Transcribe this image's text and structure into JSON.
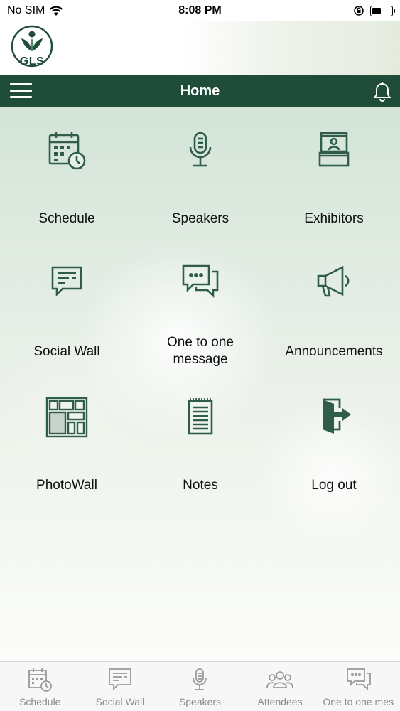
{
  "status": {
    "carrier": "No SIM",
    "time": "8:08 PM"
  },
  "brand": {
    "logo_text": "GLS"
  },
  "nav": {
    "title": "Home"
  },
  "menu": [
    {
      "label": "Schedule",
      "icon": "calendar-clock-icon"
    },
    {
      "label": "Speakers",
      "icon": "microphone-icon"
    },
    {
      "label": "Exhibitors",
      "icon": "exhibitor-booth-icon"
    },
    {
      "label": "Social Wall",
      "icon": "chat-bubble-icon"
    },
    {
      "label": "One to one message",
      "icon": "chat-bubbles-icon"
    },
    {
      "label": "Announcements",
      "icon": "megaphone-icon"
    },
    {
      "label": "PhotoWall",
      "icon": "photo-wall-icon"
    },
    {
      "label": "Notes",
      "icon": "notepad-icon"
    },
    {
      "label": "Log out",
      "icon": "logout-door-icon"
    }
  ],
  "tabs": [
    {
      "label": "Schedule",
      "icon": "calendar-clock-icon"
    },
    {
      "label": "Social Wall",
      "icon": "chat-bubble-icon"
    },
    {
      "label": "Speakers",
      "icon": "microphone-icon"
    },
    {
      "label": "Attendees",
      "icon": "people-icon"
    },
    {
      "label": "One to one mes",
      "icon": "chat-bubbles-icon"
    }
  ],
  "colors": {
    "primary": "#1f4d3a",
    "icon": "#2f5d4a",
    "tab_icon": "#9a9a9a"
  }
}
